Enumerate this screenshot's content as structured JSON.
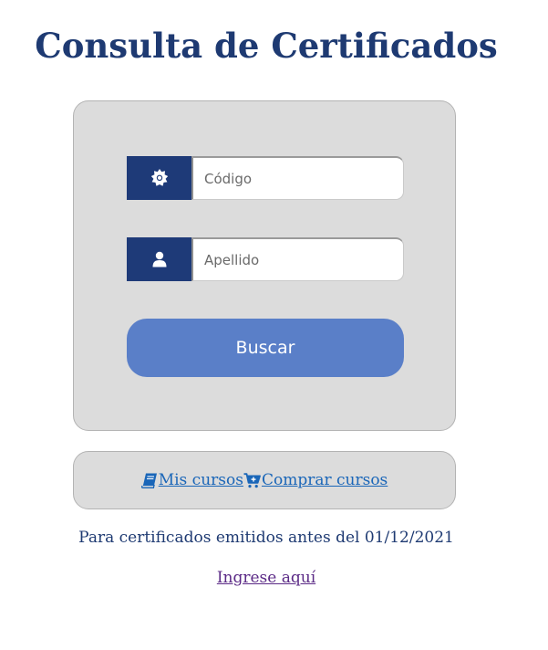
{
  "page": {
    "title": "Consulta de Certificados"
  },
  "form": {
    "code_placeholder": "Código",
    "code_icon": "certificate-seal-icon",
    "surname_placeholder": "Apellido",
    "surname_icon": "user-icon",
    "search_label": "Buscar"
  },
  "links": {
    "my_courses_label": "Mis cursos",
    "my_courses_icon": "book-icon",
    "buy_courses_label": "Comprar cursos",
    "buy_courses_icon": "cart-plus-icon"
  },
  "footer": {
    "note": "Para certificados emitidos antes del 01/12/2021",
    "legacy_link_label": "Ingrese aquí"
  },
  "colors": {
    "primary": "#1e3a78",
    "button": "#5a7fc8",
    "card_bg": "#dcdcdc",
    "link": "#1a66b8",
    "visited_link": "#5b2a86"
  }
}
